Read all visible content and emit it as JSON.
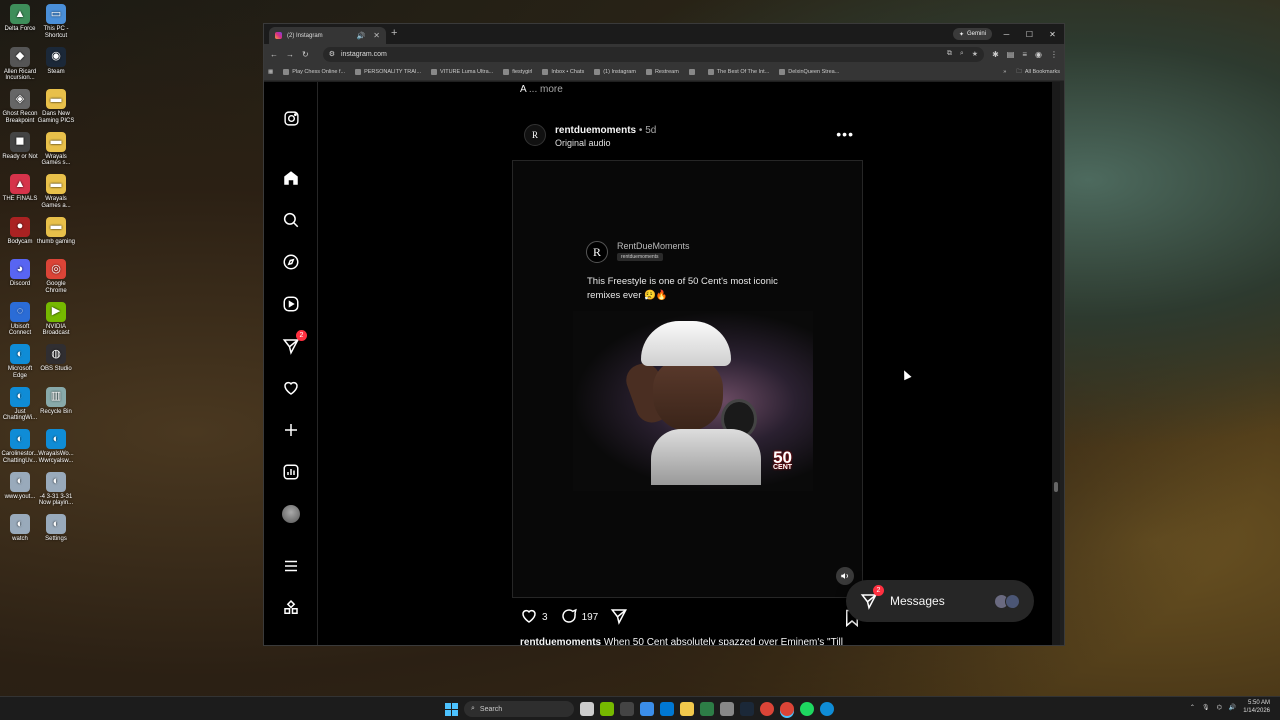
{
  "desktop": {
    "icons": [
      {
        "label": "Delta Force",
        "color": "#3e8e5a",
        "glyph": "▲"
      },
      {
        "label": "This PC - Shortcut",
        "color": "#4a8fd8",
        "glyph": "▭"
      },
      {
        "label": "Allen Ricard Incursion...",
        "color": "#555",
        "glyph": "◆"
      },
      {
        "label": "Steam",
        "color": "#1b2838",
        "glyph": "◉"
      },
      {
        "label": "Ghost Recon Breakpoint",
        "color": "#666",
        "glyph": "◈"
      },
      {
        "label": "Dans New Gaming PICS",
        "color": "#e8c04a",
        "glyph": "▬"
      },
      {
        "label": "Ready or Not",
        "color": "#444",
        "glyph": "◼"
      },
      {
        "label": "Wrayals Games s...",
        "color": "#e8c04a",
        "glyph": "▬"
      },
      {
        "label": "THE FINALS",
        "color": "#d6334a",
        "glyph": "▲"
      },
      {
        "label": "Wrayals Games a...",
        "color": "#e8c04a",
        "glyph": "▬"
      },
      {
        "label": "Bodycam",
        "color": "#a22",
        "glyph": "●"
      },
      {
        "label": "thumb gaming",
        "color": "#e8c04a",
        "glyph": "▬"
      },
      {
        "label": "Discord",
        "color": "#5865f2",
        "glyph": "◕"
      },
      {
        "label": "Google Chrome",
        "color": "#db4437",
        "glyph": "◎"
      },
      {
        "label": "Ubisoft Connect",
        "color": "#2b6cd6",
        "glyph": "◌"
      },
      {
        "label": "NVIDIA Broadcast",
        "color": "#76b900",
        "glyph": "▶"
      },
      {
        "label": "Microsoft Edge",
        "color": "#0f8cd6",
        "glyph": "◐"
      },
      {
        "label": "OBS Studio",
        "color": "#302e31",
        "glyph": "◍"
      },
      {
        "label": "Just ChattingWi...",
        "color": "#0f8cd6",
        "glyph": "◐"
      },
      {
        "label": "Recycle Bin",
        "color": "#8aa",
        "glyph": "▥"
      },
      {
        "label": "Carolinestor... ChattingUv...",
        "color": "#0f8cd6",
        "glyph": "◐"
      },
      {
        "label": "WrayalsWo... Wwrcyalsw...",
        "color": "#0f8cd6",
        "glyph": "◐"
      },
      {
        "label": "www.yout...",
        "color": "#9ab",
        "glyph": "◐"
      },
      {
        "label": "-4 3-31 3-31 Now playin...",
        "color": "#9ab",
        "glyph": "◐"
      },
      {
        "label": "watch",
        "color": "#9ab",
        "glyph": "◐"
      },
      {
        "label": "Settings",
        "color": "#9ab",
        "glyph": "◐"
      }
    ]
  },
  "browser": {
    "tab_title": "(2) Instagram",
    "gemini_label": "Gemini",
    "url": "instagram.com",
    "bookmarks": [
      "Play Chess Online f...",
      "PERSONALITY TRAI...",
      "VITURE Luma Ultra...",
      "fiestygirl",
      "Inbox • Chats",
      "(1) Instagram",
      "Restream",
      "",
      "The Best Of The Int...",
      "DelxinQueen Strea..."
    ],
    "all_bookmarks": "All Bookmarks"
  },
  "post": {
    "prev_caption_end": "A",
    "prev_more": "... more",
    "username": "rentduemoments",
    "age": "5d",
    "audio": "Original audio",
    "avatar_letter": "R",
    "card": {
      "name": "RentDueMoments",
      "handle": "rentduemoments",
      "text": "This Freestyle is one of 50 Cent's most iconic remixes ever 😮‍💨🔥",
      "logo_big": "50",
      "logo_small": "CENT"
    },
    "likes": "3",
    "comments": "197",
    "caption_user": "rentduemoments",
    "caption_text": "When 50 Cent absolutely spazzed over Eminem's \"Till"
  },
  "messages": {
    "label": "Messages",
    "badge": "2"
  },
  "sidebar": {
    "notif_badge": "2"
  },
  "taskbar": {
    "search_placeholder": "Search",
    "time": "5:50 AM",
    "date": "1/14/2026"
  }
}
